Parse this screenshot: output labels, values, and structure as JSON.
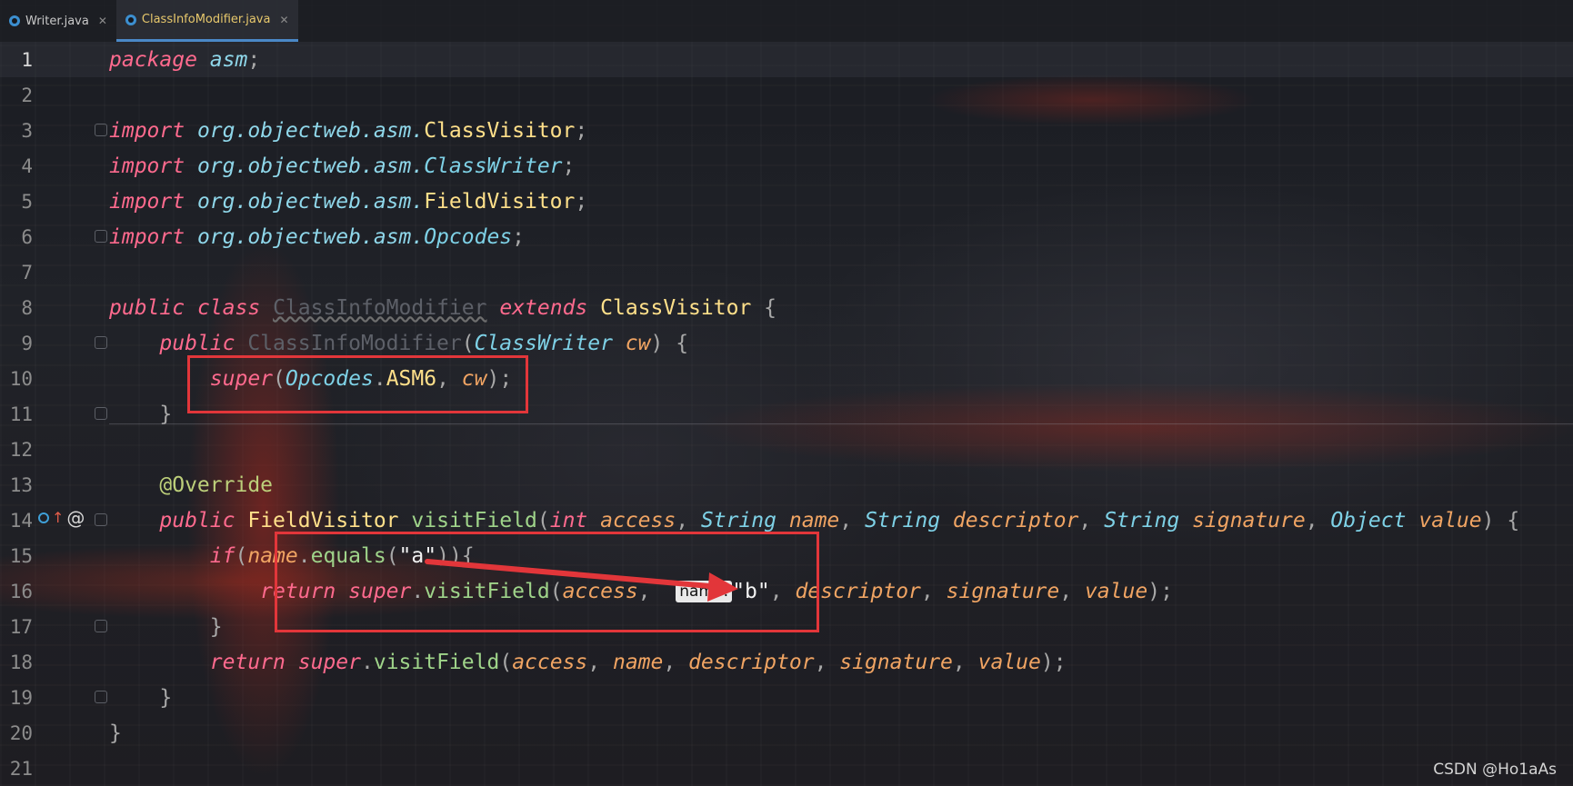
{
  "tabs": [
    {
      "label": "Writer.java",
      "active": false
    },
    {
      "label": "ClassInfoModifier.java",
      "active": true
    }
  ],
  "lines": {
    "n1": "1",
    "n2": "2",
    "n3": "3",
    "n4": "4",
    "n5": "5",
    "n6": "6",
    "n7": "7",
    "n8": "8",
    "n9": "9",
    "n10": "10",
    "n11": "11",
    "n12": "12",
    "n13": "13",
    "n14": "14",
    "n15": "15",
    "n16": "16",
    "n17": "17",
    "n18": "18",
    "n19": "19",
    "n20": "20",
    "n21": "21"
  },
  "code": {
    "kw_package": "package",
    "pkg_asm": "asm",
    "semi": ";",
    "kw_import": "import",
    "pkg_prefix": "org.objectweb.asm.",
    "cls_ClassVisitor": "ClassVisitor",
    "cls_ClassWriter": "ClassWriter",
    "cls_FieldVisitor": "FieldVisitor",
    "typ_Opcodes": "Opcodes",
    "kw_public": "public",
    "kw_class": "class",
    "class_name": "ClassInfoModifier",
    "kw_extends": "extends",
    "brace_open": "{",
    "brace_close": "}",
    "paren_open": "(",
    "paren_close": ")",
    "param_cw": "cw",
    "kw_super": "super",
    "asm6": "ASM6",
    "comma": ", ",
    "dot": ".",
    "annotation": "@Override",
    "method_visitField": "visitField",
    "kw_int": "int",
    "param_access": "access",
    "typ_String": "String",
    "param_name": "name",
    "param_descriptor": "descriptor",
    "param_signature": "signature",
    "typ_Object": "Object",
    "param_value": "value",
    "kw_if": "if",
    "method_equals": "equals",
    "str_a": "\"a\"",
    "kw_return": "return",
    "hint_name": "name:",
    "str_b": "\"b\""
  },
  "watermark": "CSDN @Ho1aAs",
  "colors": {
    "keyword": "#ff6a8e",
    "class": "#ffe08a",
    "parameter": "#f0a463",
    "method": "#9fd48a",
    "highlight_box": "#e2363a"
  }
}
